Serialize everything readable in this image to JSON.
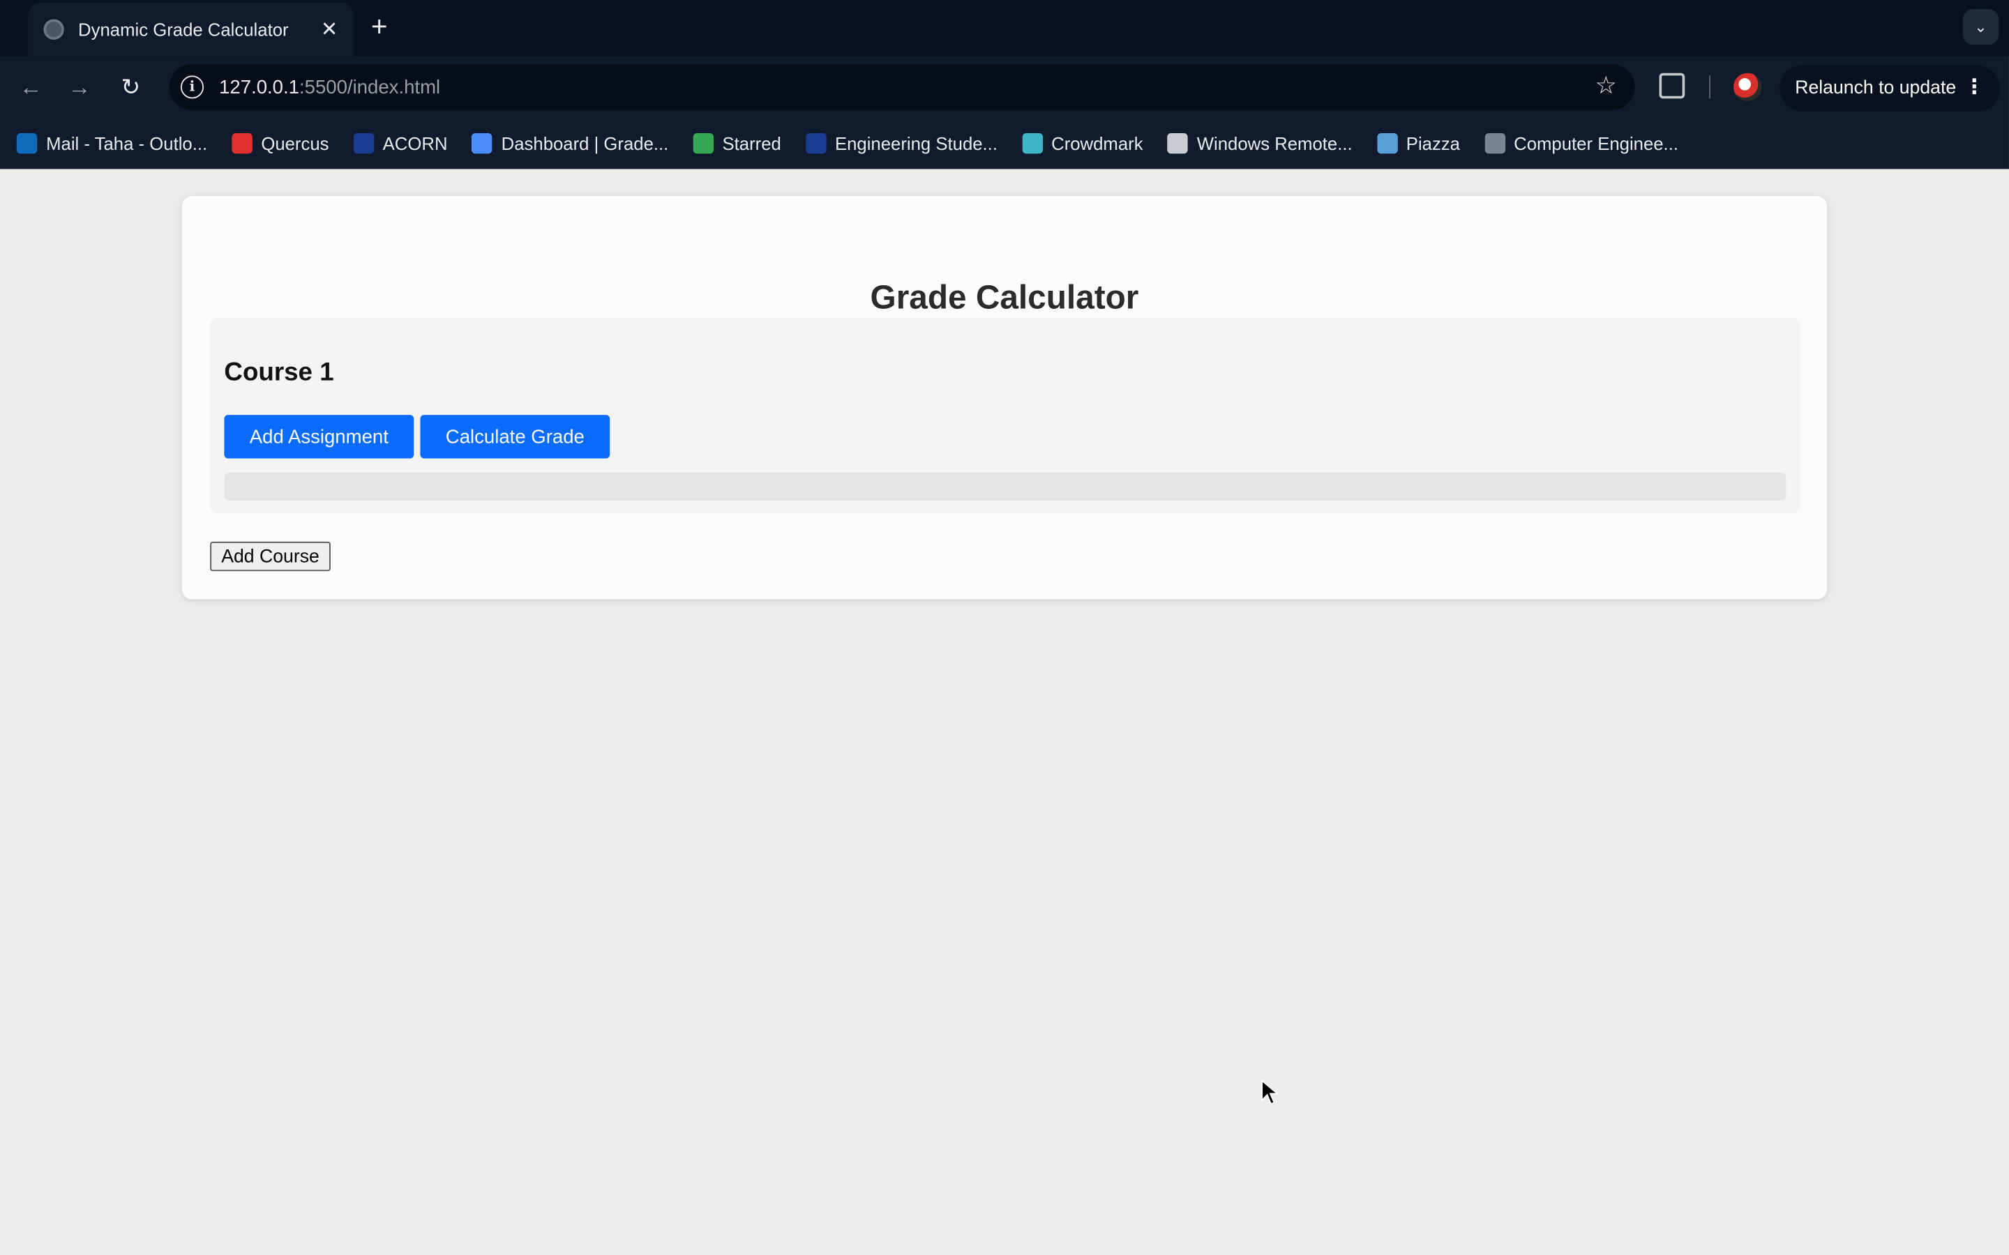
{
  "browser": {
    "tab_title": "Dynamic Grade Calculator",
    "tab_close": "✕",
    "new_tab": "+",
    "url_host": "127.0.0.1",
    "url_rest": ":5500/index.html",
    "relaunch_label": "Relaunch to update",
    "bookmarks": [
      {
        "label": "Mail - Taha - Outlo...",
        "icon": "outlook-icon",
        "color": "#0f6cbd"
      },
      {
        "label": "Quercus",
        "icon": "quercus-icon",
        "color": "#e0312e"
      },
      {
        "label": "ACORN",
        "icon": "acorn-icon",
        "color": "#1a3d8f"
      },
      {
        "label": "Dashboard | Grade...",
        "icon": "dashboard-icon",
        "color": "#4b8df8"
      },
      {
        "label": "Starred",
        "icon": "drive-icon",
        "color": "#34a853"
      },
      {
        "label": "Engineering Stude...",
        "icon": "engineering-icon",
        "color": "#1a3d8f"
      },
      {
        "label": "Crowdmark",
        "icon": "crowdmark-icon",
        "color": "#3fb6c8"
      },
      {
        "label": "Windows Remote...",
        "icon": "remote-desktop-icon",
        "color": "#c9ccd1"
      },
      {
        "label": "Piazza",
        "icon": "piazza-icon",
        "color": "#5aa0d8"
      },
      {
        "label": "Computer Enginee...",
        "icon": "computer-engineering-icon",
        "color": "#7a8594"
      }
    ]
  },
  "page": {
    "title": "Grade Calculator",
    "course": {
      "title": "Course 1",
      "add_assignment_label": "Add Assignment",
      "calculate_grade_label": "Calculate Grade"
    },
    "add_course_label": "Add Course"
  },
  "colors": {
    "primary_button": "#0a6cff",
    "page_background": "#ececec",
    "browser_frame": "#0f1b2d"
  }
}
